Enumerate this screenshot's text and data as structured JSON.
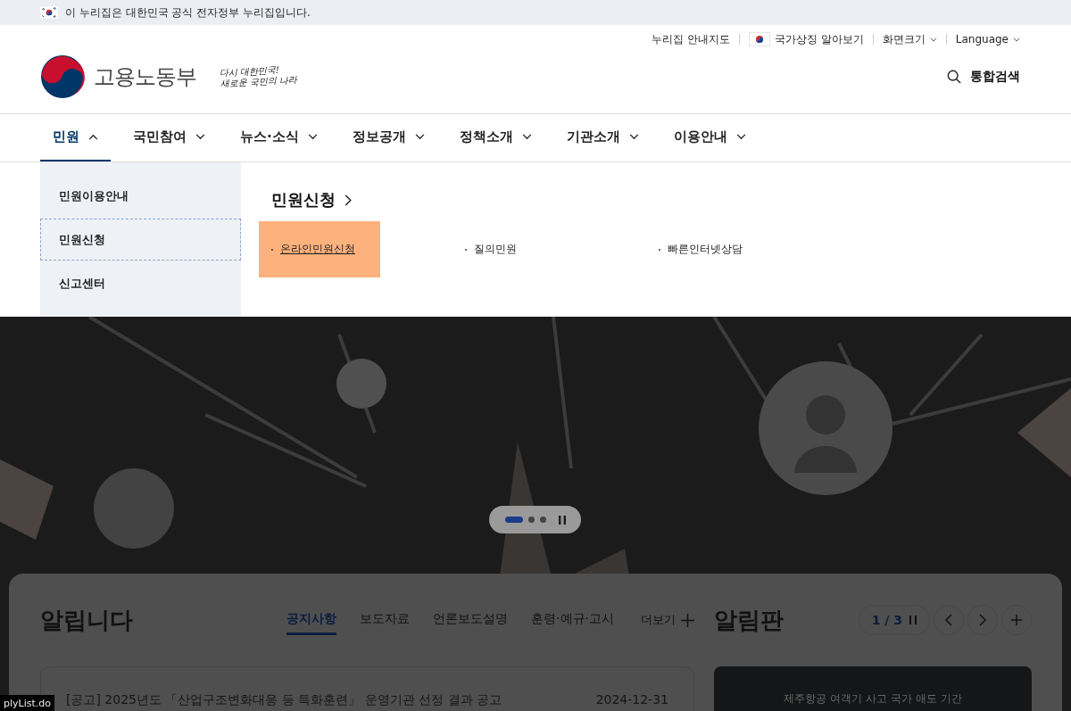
{
  "gov_banner": {
    "text": "이 누리집은 대한민국 공식 전자정부 누리집입니다."
  },
  "utility_links": [
    {
      "label": "누리집 안내지도",
      "kind": "plain"
    },
    {
      "label": "국가상징 알아보기",
      "kind": "flag"
    },
    {
      "label": "화면크기",
      "kind": "dropdown"
    },
    {
      "label": "Language",
      "kind": "dropdown"
    }
  ],
  "logo": {
    "name": "고용노동부",
    "slogan_line1": "다시 대한민국!",
    "slogan_line2": "새로운 국민의 나라"
  },
  "search": {
    "label": "통합검색"
  },
  "nav": [
    {
      "label": "민원",
      "expanded": true
    },
    {
      "label": "국민참여",
      "expanded": false
    },
    {
      "label": "뉴스·소식",
      "expanded": false
    },
    {
      "label": "정보공개",
      "expanded": false
    },
    {
      "label": "정책소개",
      "expanded": false
    },
    {
      "label": "기관소개",
      "expanded": false
    },
    {
      "label": "이용안내",
      "expanded": false
    }
  ],
  "submenu": [
    {
      "label": "민원이용안내",
      "selected": false
    },
    {
      "label": "민원신청",
      "selected": true
    },
    {
      "label": "신고센터",
      "selected": false
    }
  ],
  "submenu_panel": {
    "title": "민원신청",
    "links": [
      {
        "label": "온라인민원신청",
        "selected": true
      },
      {
        "label": "질의민원",
        "selected": false
      },
      {
        "label": "빠른인터넷상담",
        "selected": false
      }
    ]
  },
  "carousel": {
    "dots": [
      {
        "selected": true
      },
      {
        "selected": false
      },
      {
        "selected": false
      }
    ]
  },
  "notices": {
    "title": "알립니다",
    "tabs": [
      {
        "label": "공지사항",
        "selected": true
      },
      {
        "label": "보도자료",
        "selected": false
      },
      {
        "label": "언론보도설명",
        "selected": false
      },
      {
        "label": "훈령·예규·고시",
        "selected": false
      }
    ],
    "more": "더보기",
    "items": [
      {
        "title": "[공고] 2025년도 「산업구조변화대응 등 특화훈련」 운영기관 선정 결과 공고",
        "date": "2024-12-31"
      }
    ]
  },
  "board": {
    "title": "알림판",
    "page": "1 / 3",
    "banner_text": "제주항공 여객기 사고 국가 애도 기간"
  },
  "status_url": "plyList.do"
}
